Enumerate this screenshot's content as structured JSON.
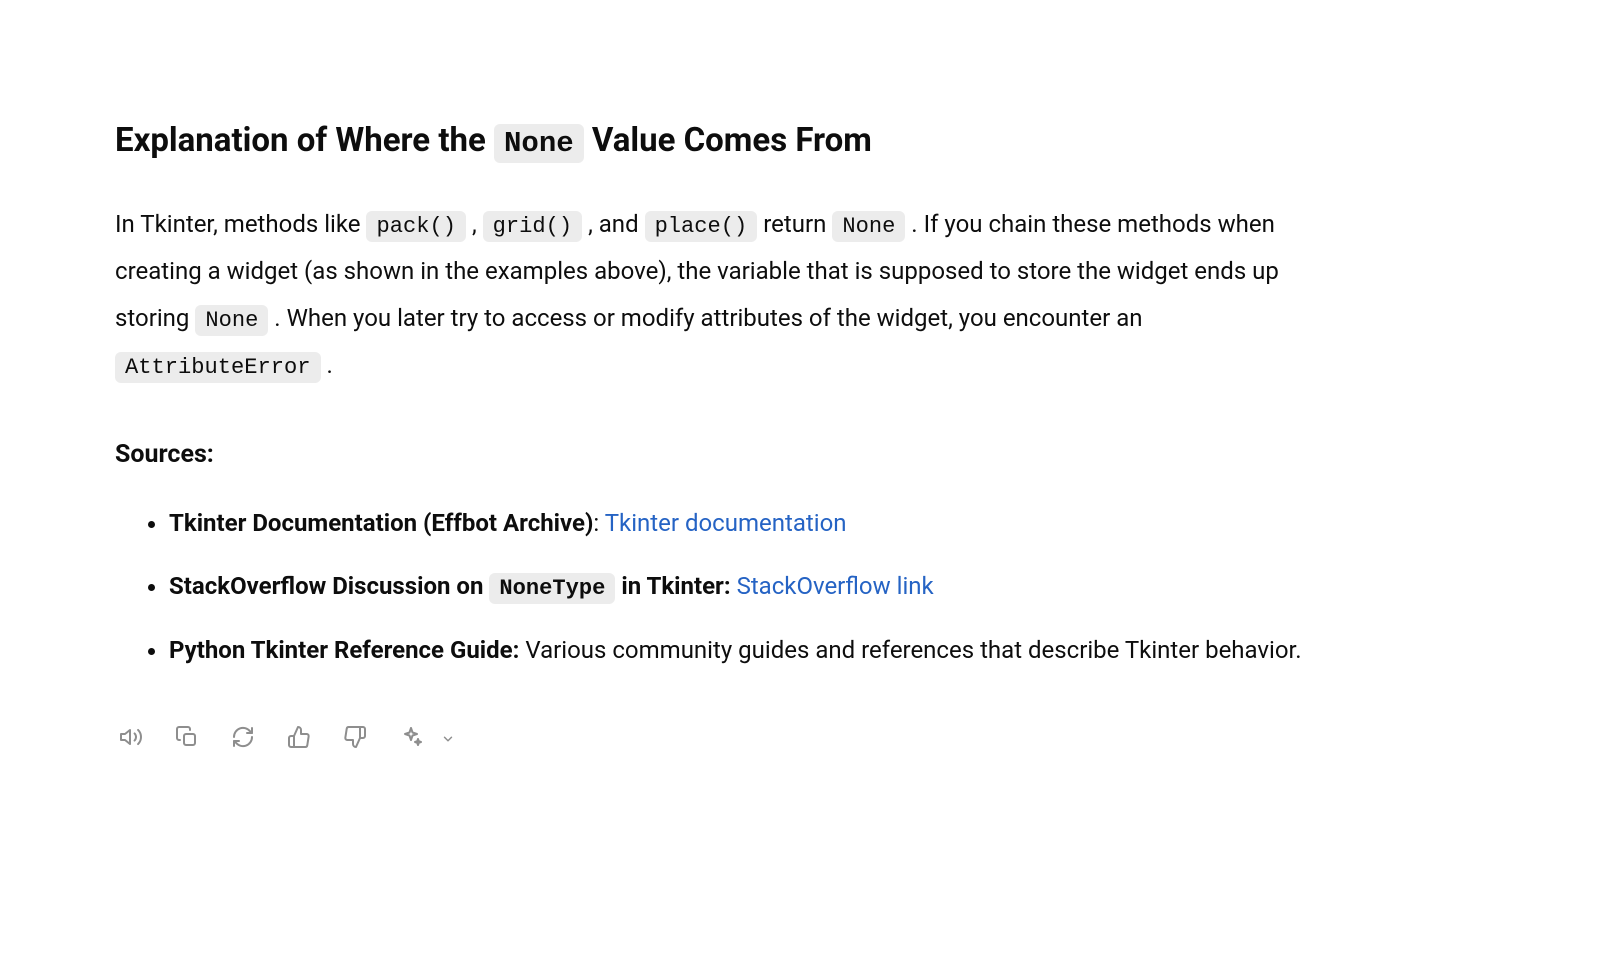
{
  "heading": {
    "prefix": "Explanation of Where the ",
    "code": "None",
    "suffix": " Value Comes From"
  },
  "explanation": {
    "part1": "In Tkinter, methods like ",
    "code1": "pack()",
    "sep1": " , ",
    "code2": "grid()",
    "sep2": " , and ",
    "code3": "place()",
    "part2": " return ",
    "code4": "None",
    "part3": " . If you chain these methods when creating a widget (as shown in the examples above), the variable that is supposed to store the widget ends up storing ",
    "code5": "None",
    "part4": " . When you later try to access or modify attributes of the widget, you encounter an ",
    "code6": "AttributeError",
    "part5": " ."
  },
  "sources_heading": "Sources:",
  "sources": [
    {
      "bold": "Tkinter Documentation (Effbot Archive)",
      "after_bold": ": ",
      "link_text": "Tkinter documentation",
      "tail": ""
    },
    {
      "bold_prefix": "StackOverflow Discussion on ",
      "bold_code": "NoneType",
      "bold_suffix": " in Tkinter:",
      "after_bold": " ",
      "link_text": "StackOverflow link",
      "tail": ""
    },
    {
      "bold": "Python Tkinter Reference Guide:",
      "after_bold": " ",
      "tail": "Various community guides and references that describe Tkinter behavior."
    }
  ]
}
